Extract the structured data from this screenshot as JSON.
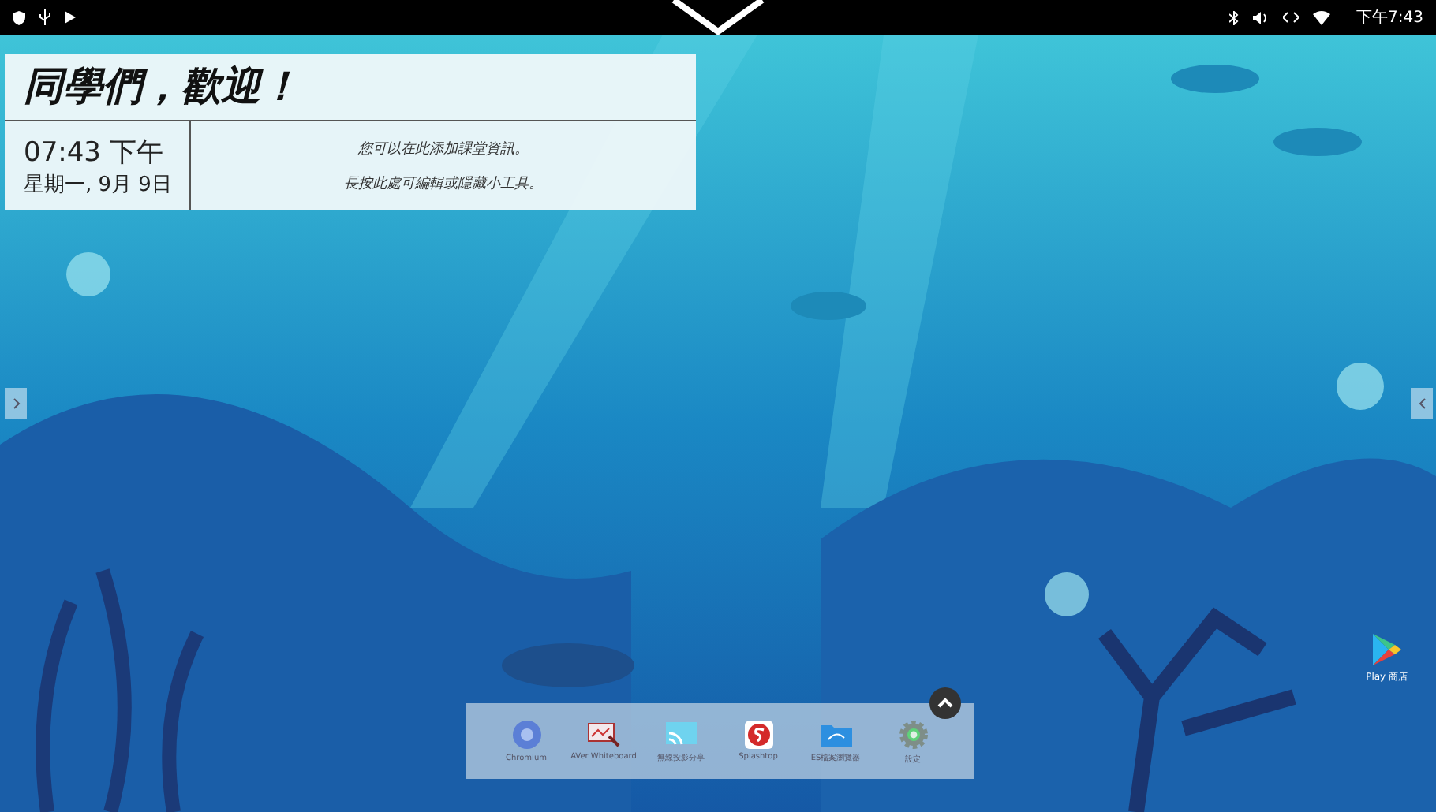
{
  "status_bar": {
    "time": "下午7:43"
  },
  "widget": {
    "title": "同學們，歡迎！",
    "time": "07:43 下午",
    "date": "星期一, 9月 9日",
    "messages": [
      "您可以在此添加課堂資訊。",
      "長按此處可編輯或隱藏小工具。"
    ]
  },
  "desktop_icons": [
    {
      "label": "Play 商店"
    }
  ],
  "dock": {
    "apps": [
      {
        "kind": "chromium",
        "label": "Chromium"
      },
      {
        "kind": "whiteboard",
        "label": "AVer Whiteboard"
      },
      {
        "kind": "cast",
        "label": "無線投影分享"
      },
      {
        "kind": "splashtop",
        "label": "Splashtop"
      },
      {
        "kind": "files",
        "label": "ES檔案瀏覽器"
      },
      {
        "kind": "settings",
        "label": "設定"
      }
    ]
  }
}
